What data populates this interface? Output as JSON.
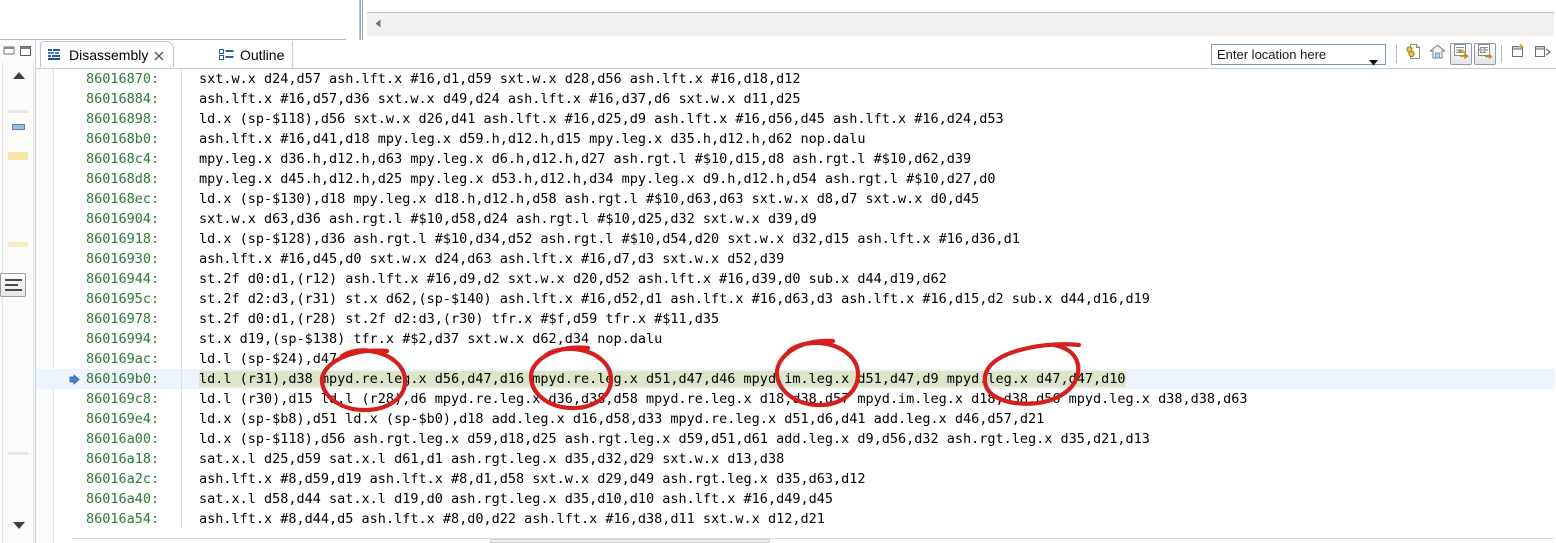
{
  "window": {
    "view_title": "Disassembly"
  },
  "tabs": [
    {
      "label": "Disassembly",
      "icon": "disassembly-icon",
      "active": true,
      "closable": true
    },
    {
      "label": "Outline",
      "icon": "outline-icon",
      "active": false,
      "closable": false
    }
  ],
  "toolbar": {
    "location_combo": {
      "value": "Enter location here",
      "placeholder": "Enter location here",
      "caret_icon": "chevron-down-icon"
    },
    "buttons": [
      {
        "name": "link-with-source-button",
        "icon": "linked-document-icon",
        "toggled": false
      },
      {
        "name": "home-button",
        "icon": "home-icon",
        "toggled": false
      },
      {
        "name": "show-address-button",
        "icon": "address-toggle-icon",
        "toggled": true
      },
      {
        "name": "show-opcodes-button",
        "icon": "opcodes-toggle-icon",
        "toggled": true
      },
      {
        "name": "new-window-button",
        "icon": "new-window-icon",
        "toggled": false
      },
      {
        "name": "view-menu-button",
        "icon": "view-menu-icon",
        "toggled": false
      }
    ]
  },
  "colors": {
    "address_text": "#2f7a38",
    "instruction_text": "#000000",
    "selected_row_bg": "#edf4fb",
    "highlight_bg": "#dde5c8",
    "annotation_red": "#d62020",
    "tab_border": "#b8c6d4"
  },
  "editor": {
    "current_line_address": "860169b0",
    "lines": [
      {
        "addr": "86016870:",
        "instr": "sxt.w.x d24,d57 ash.lft.x #16,d1,d59 sxt.w.x d28,d56 ash.lft.x #16,d18,d12",
        "current": false
      },
      {
        "addr": "86016884:",
        "instr": "ash.lft.x #16,d57,d36 sxt.w.x d49,d24 ash.lft.x #16,d37,d6 sxt.w.x d11,d25",
        "current": false
      },
      {
        "addr": "86016898:",
        "instr": "ld.x (sp-$118),d56 sxt.w.x d26,d41 ash.lft.x #16,d25,d9 ash.lft.x #16,d56,d45 ash.lft.x #16,d24,d53",
        "current": false
      },
      {
        "addr": "860168b0:",
        "instr": "ash.lft.x #16,d41,d18 mpy.leg.x d59.h,d12.h,d15 mpy.leg.x d35.h,d12.h,d62 nop.dalu",
        "current": false
      },
      {
        "addr": "860168c4:",
        "instr": "mpy.leg.x d36.h,d12.h,d63 mpy.leg.x d6.h,d12.h,d27 ash.rgt.l #$10,d15,d8 ash.rgt.l #$10,d62,d39",
        "current": false
      },
      {
        "addr": "860168d8:",
        "instr": "mpy.leg.x d45.h,d12.h,d25 mpy.leg.x d53.h,d12.h,d34 mpy.leg.x d9.h,d12.h,d54 ash.rgt.l #$10,d27,d0",
        "current": false
      },
      {
        "addr": "860168ec:",
        "instr": "ld.x (sp-$130),d18 mpy.leg.x d18.h,d12.h,d58 ash.rgt.l #$10,d63,d63 sxt.w.x d8,d7 sxt.w.x d0,d45",
        "current": false
      },
      {
        "addr": "86016904:",
        "instr": "sxt.w.x d63,d36 ash.rgt.l #$10,d58,d24 ash.rgt.l #$10,d25,d32 sxt.w.x d39,d9",
        "current": false
      },
      {
        "addr": "86016918:",
        "instr": "ld.x (sp-$128),d36 ash.rgt.l #$10,d34,d52 ash.rgt.l #$10,d54,d20 sxt.w.x d32,d15 ash.lft.x #16,d36,d1",
        "current": false
      },
      {
        "addr": "86016930:",
        "instr": "ash.lft.x #16,d45,d0 sxt.w.x d24,d63 ash.lft.x #16,d7,d3 sxt.w.x d52,d39",
        "current": false
      },
      {
        "addr": "86016944:",
        "instr": "st.2f d0:d1,(r12) ash.lft.x #16,d9,d2 sxt.w.x d20,d52 ash.lft.x #16,d39,d0 sub.x d44,d19,d62",
        "current": false
      },
      {
        "addr": "8601695c:",
        "instr": "st.2f d2:d3,(r31) st.x d62,(sp-$140) ash.lft.x #16,d52,d1 ash.lft.x #16,d63,d3 ash.lft.x #16,d15,d2 sub.x d44,d16,d19",
        "current": false
      },
      {
        "addr": "86016978:",
        "instr": "st.2f d0:d1,(r28) st.2f d2:d3,(r30) tfr.x #$f,d59 tfr.x #$11,d35",
        "current": false
      },
      {
        "addr": "86016994:",
        "instr": "st.x d19,(sp-$138) tfr.x #$2,d37 sxt.w.x d62,d34 nop.dalu",
        "current": false
      },
      {
        "addr": "860169ac:",
        "instr": "ld.l (sp-$24),d47",
        "current": false
      },
      {
        "addr": "860169b0:",
        "instr": "ld.l (r31),d38 mpyd.re.leg.x d56,d47,d16 mpyd.re.leg.x d51,d47,d46 mpyd.im.leg.x d51,d47,d9 mpyd.leg.x d47,d47,d10",
        "current": true
      },
      {
        "addr": "860169c8:",
        "instr": "ld.l (r30),d15 ld.l (r28),d6 mpyd.re.leg.x d36,d38,d58 mpyd.re.leg.x d18,d38,d57 mpyd.im.leg.x d18,d38,d56 mpyd.leg.x d38,d38,d63",
        "current": false
      },
      {
        "addr": "860169e4:",
        "instr": "ld.x (sp-$b8),d51 ld.x (sp-$b0),d18 add.leg.x d16,d58,d33 mpyd.re.leg.x d51,d6,d41 add.leg.x d46,d57,d21",
        "current": false
      },
      {
        "addr": "86016a00:",
        "instr": "ld.x (sp-$118),d56 ash.rgt.leg.x d59,d18,d25 ash.rgt.leg.x d59,d51,d61 add.leg.x d9,d56,d32 ash.rgt.leg.x d35,d21,d13",
        "current": false
      },
      {
        "addr": "86016a18:",
        "instr": "sat.x.l d25,d59 sat.x.l d61,d1 ash.rgt.leg.x d35,d32,d29 sxt.w.x d13,d38",
        "current": false
      },
      {
        "addr": "86016a2c:",
        "instr": "ash.lft.x #8,d59,d19 ash.lft.x #8,d1,d58 sxt.w.x d29,d49 ash.rgt.leg.x d35,d63,d12",
        "current": false
      },
      {
        "addr": "86016a40:",
        "instr": "sat.x.l d58,d44 sat.x.l d19,d0 ash.rgt.leg.x d35,d10,d10 ash.lft.x #16,d49,d45",
        "current": false
      },
      {
        "addr": "86016a54:",
        "instr": "ash.lft.x #8,d44,d5 ash.lft.x #8,d0,d22 ash.lft.x #16,d38,d11 sxt.w.x d12,d21",
        "current": false
      }
    ]
  },
  "annotations": {
    "color": "#d62020",
    "description": "Four hand-drawn red circles highlighting mpyd operands on the current line",
    "circles": [
      {
        "name": "annotation-circle-1",
        "label": "mpyd.re"
      },
      {
        "name": "annotation-circle-2",
        "label": "mpyd.re"
      },
      {
        "name": "annotation-circle-3",
        "label": "mpyd.im"
      },
      {
        "name": "annotation-circle-4",
        "label": "mpyd"
      }
    ]
  }
}
